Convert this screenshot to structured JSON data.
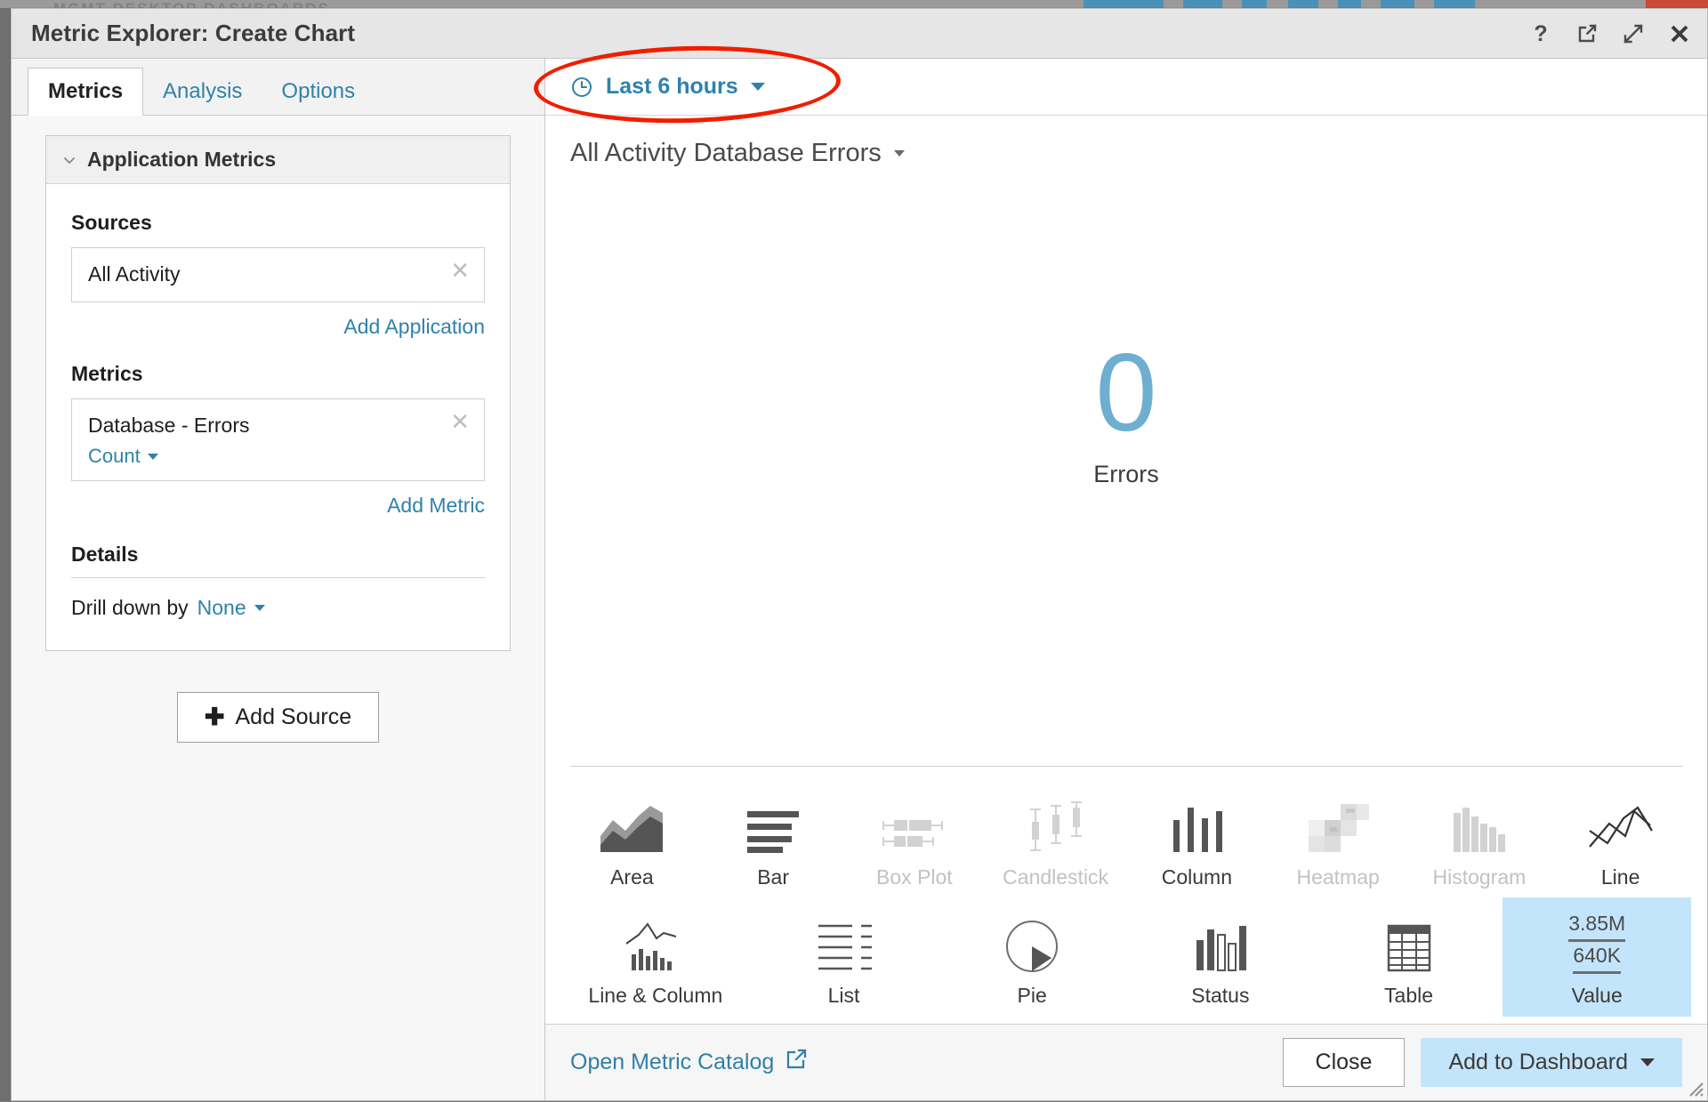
{
  "backdrop": {
    "ghost_text": "MGMT      DESKTOP      DASHBOARDS"
  },
  "titlebar": {
    "title": "Metric Explorer: Create Chart",
    "actions": [
      {
        "name": "help-icon",
        "label": "?"
      },
      {
        "name": "popout-icon",
        "label": "Open in new window"
      },
      {
        "name": "expand-icon",
        "label": "Expand"
      },
      {
        "name": "close-icon",
        "label": "Close"
      }
    ]
  },
  "tabs": [
    {
      "label": "Metrics",
      "active": true
    },
    {
      "label": "Analysis",
      "active": false
    },
    {
      "label": "Options",
      "active": false
    }
  ],
  "left_panel": {
    "card_title": "Application Metrics",
    "sources": {
      "heading": "Sources",
      "items": [
        {
          "name": "All Activity"
        }
      ],
      "add_link": "Add Application"
    },
    "metrics": {
      "heading": "Metrics",
      "items": [
        {
          "name": "Database - Errors",
          "aggregation": "Count"
        }
      ],
      "add_link": "Add Metric"
    },
    "details": {
      "heading": "Details",
      "drill_label": "Drill down by",
      "drill_value": "None"
    },
    "add_source_button": "Add Source"
  },
  "right_panel": {
    "time_range": "Last 6 hours",
    "chart_title": "All Activity Database Errors"
  },
  "chart_data": {
    "type": "value",
    "title": "All Activity Database Errors",
    "value": "0",
    "label": "Errors",
    "value_color": "#6eafd0",
    "time_range": "Last 6 hours",
    "source": "All Activity",
    "metric": "Database - Errors",
    "aggregation": "Count",
    "drill_down": "None"
  },
  "viz_types": {
    "selected": "Value",
    "row1": [
      {
        "label": "Area",
        "icon": "area-chart-icon",
        "enabled": true,
        "selected": false
      },
      {
        "label": "Bar",
        "icon": "bar-chart-icon",
        "enabled": true,
        "selected": false
      },
      {
        "label": "Box Plot",
        "icon": "box-plot-icon",
        "enabled": false,
        "selected": false
      },
      {
        "label": "Candlestick",
        "icon": "candlestick-chart-icon",
        "enabled": false,
        "selected": false
      },
      {
        "label": "Column",
        "icon": "column-chart-icon",
        "enabled": true,
        "selected": false
      },
      {
        "label": "Heatmap",
        "icon": "heatmap-icon",
        "enabled": false,
        "selected": false
      },
      {
        "label": "Histogram",
        "icon": "histogram-icon",
        "enabled": false,
        "selected": false
      },
      {
        "label": "Line",
        "icon": "line-chart-icon",
        "enabled": true,
        "selected": false
      }
    ],
    "row2": [
      {
        "label": "Line & Column",
        "icon": "line-column-chart-icon",
        "enabled": true,
        "selected": false
      },
      {
        "label": "List",
        "icon": "list-icon",
        "enabled": true,
        "selected": false
      },
      {
        "label": "Pie",
        "icon": "pie-chart-icon",
        "enabled": true,
        "selected": false
      },
      {
        "label": "Status",
        "icon": "status-chart-icon",
        "enabled": true,
        "selected": false
      },
      {
        "label": "Table",
        "icon": "table-icon",
        "enabled": true,
        "selected": false
      },
      {
        "label": "Value",
        "icon": "value-tile-icon",
        "enabled": true,
        "selected": true,
        "sample_top": "3.85M",
        "sample_bottom": "640K"
      }
    ]
  },
  "footer": {
    "open_catalog": "Open Metric Catalog",
    "close": "Close",
    "add_to_dashboard": "Add to Dashboard"
  },
  "colors": {
    "accent_blue": "#2f82ab",
    "value_blue": "#6eafd0",
    "selected_tile": "#c3e5fb",
    "annotation_red": "#f01e00"
  }
}
